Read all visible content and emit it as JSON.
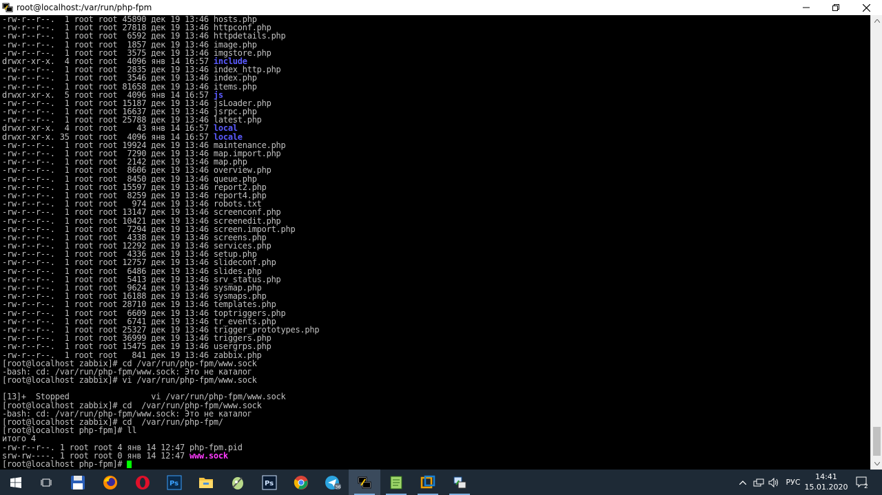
{
  "window": {
    "title": "root@localhost:/var/run/php-fpm"
  },
  "terminal": {
    "lines": [
      {
        "pre": "-rw-r--r--.  1 root root 45890 дек 19 13:46 ",
        "name": "hosts.php",
        "kind": "file"
      },
      {
        "pre": "-rw-r--r--.  1 root root 27818 дек 19 13:46 ",
        "name": "httpconf.php",
        "kind": "file"
      },
      {
        "pre": "-rw-r--r--.  1 root root  6592 дек 19 13:46 ",
        "name": "httpdetails.php",
        "kind": "file"
      },
      {
        "pre": "-rw-r--r--.  1 root root  1857 дек 19 13:46 ",
        "name": "image.php",
        "kind": "file"
      },
      {
        "pre": "-rw-r--r--.  1 root root  3575 дек 19 13:46 ",
        "name": "imgstore.php",
        "kind": "file"
      },
      {
        "pre": "drwxr-xr-x.  4 root root  4096 янв 14 16:57 ",
        "name": "include",
        "kind": "dir"
      },
      {
        "pre": "-rw-r--r--.  1 root root  2835 дек 19 13:46 ",
        "name": "index_http.php",
        "kind": "file"
      },
      {
        "pre": "-rw-r--r--.  1 root root  3546 дек 19 13:46 ",
        "name": "index.php",
        "kind": "file"
      },
      {
        "pre": "-rw-r--r--.  1 root root 81658 дек 19 13:46 ",
        "name": "items.php",
        "kind": "file"
      },
      {
        "pre": "drwxr-xr-x.  5 root root  4096 янв 14 16:57 ",
        "name": "js",
        "kind": "dir"
      },
      {
        "pre": "-rw-r--r--.  1 root root 15187 дек 19 13:46 ",
        "name": "jsLoader.php",
        "kind": "file"
      },
      {
        "pre": "-rw-r--r--.  1 root root 16637 дек 19 13:46 ",
        "name": "jsrpc.php",
        "kind": "file"
      },
      {
        "pre": "-rw-r--r--.  1 root root 25788 дек 19 13:46 ",
        "name": "latest.php",
        "kind": "file"
      },
      {
        "pre": "drwxr-xr-x.  4 root root    43 янв 14 16:57 ",
        "name": "local",
        "kind": "dir"
      },
      {
        "pre": "drwxr-xr-x. 35 root root  4096 янв 14 16:57 ",
        "name": "locale",
        "kind": "dir"
      },
      {
        "pre": "-rw-r--r--.  1 root root 19924 дек 19 13:46 ",
        "name": "maintenance.php",
        "kind": "file"
      },
      {
        "pre": "-rw-r--r--.  1 root root  7290 дек 19 13:46 ",
        "name": "map.import.php",
        "kind": "file"
      },
      {
        "pre": "-rw-r--r--.  1 root root  2142 дек 19 13:46 ",
        "name": "map.php",
        "kind": "file"
      },
      {
        "pre": "-rw-r--r--.  1 root root  8606 дек 19 13:46 ",
        "name": "overview.php",
        "kind": "file"
      },
      {
        "pre": "-rw-r--r--.  1 root root  8450 дек 19 13:46 ",
        "name": "queue.php",
        "kind": "file"
      },
      {
        "pre": "-rw-r--r--.  1 root root 15597 дек 19 13:46 ",
        "name": "report2.php",
        "kind": "file"
      },
      {
        "pre": "-rw-r--r--.  1 root root  8259 дек 19 13:46 ",
        "name": "report4.php",
        "kind": "file"
      },
      {
        "pre": "-rw-r--r--.  1 root root   974 дек 19 13:46 ",
        "name": "robots.txt",
        "kind": "file"
      },
      {
        "pre": "-rw-r--r--.  1 root root 13147 дек 19 13:46 ",
        "name": "screenconf.php",
        "kind": "file"
      },
      {
        "pre": "-rw-r--r--.  1 root root 10421 дек 19 13:46 ",
        "name": "screenedit.php",
        "kind": "file"
      },
      {
        "pre": "-rw-r--r--.  1 root root  7294 дек 19 13:46 ",
        "name": "screen.import.php",
        "kind": "file"
      },
      {
        "pre": "-rw-r--r--.  1 root root  4338 дек 19 13:46 ",
        "name": "screens.php",
        "kind": "file"
      },
      {
        "pre": "-rw-r--r--.  1 root root 12292 дек 19 13:46 ",
        "name": "services.php",
        "kind": "file"
      },
      {
        "pre": "-rw-r--r--.  1 root root  4336 дек 19 13:46 ",
        "name": "setup.php",
        "kind": "file"
      },
      {
        "pre": "-rw-r--r--.  1 root root 12757 дек 19 13:46 ",
        "name": "slideconf.php",
        "kind": "file"
      },
      {
        "pre": "-rw-r--r--.  1 root root  6486 дек 19 13:46 ",
        "name": "slides.php",
        "kind": "file"
      },
      {
        "pre": "-rw-r--r--.  1 root root  5413 дек 19 13:46 ",
        "name": "srv_status.php",
        "kind": "file"
      },
      {
        "pre": "-rw-r--r--.  1 root root  9624 дек 19 13:46 ",
        "name": "sysmap.php",
        "kind": "file"
      },
      {
        "pre": "-rw-r--r--.  1 root root 16188 дек 19 13:46 ",
        "name": "sysmaps.php",
        "kind": "file"
      },
      {
        "pre": "-rw-r--r--.  1 root root 28710 дек 19 13:46 ",
        "name": "templates.php",
        "kind": "file"
      },
      {
        "pre": "-rw-r--r--.  1 root root  6609 дек 19 13:46 ",
        "name": "toptriggers.php",
        "kind": "file"
      },
      {
        "pre": "-rw-r--r--.  1 root root  6741 дек 19 13:46 ",
        "name": "tr_events.php",
        "kind": "file"
      },
      {
        "pre": "-rw-r--r--.  1 root root 25327 дек 19 13:46 ",
        "name": "trigger_prototypes.php",
        "kind": "file"
      },
      {
        "pre": "-rw-r--r--.  1 root root 36999 дек 19 13:46 ",
        "name": "triggers.php",
        "kind": "file"
      },
      {
        "pre": "-rw-r--r--.  1 root root 15475 дек 19 13:46 ",
        "name": "usergrps.php",
        "kind": "file"
      },
      {
        "pre": "-rw-r--r--.  1 root root   841 дек 19 13:46 ",
        "name": "zabbix.php",
        "kind": "file"
      },
      {
        "pre": "[root@localhost zabbix]# cd /var/run/php-fpm/www.sock",
        "name": "",
        "kind": "text"
      },
      {
        "pre": "-bash: cd: /var/run/php-fpm/www.sock: Это не каталог",
        "name": "",
        "kind": "text"
      },
      {
        "pre": "[root@localhost zabbix]# vi /var/run/php-fpm/www.sock",
        "name": "",
        "kind": "text"
      },
      {
        "pre": "",
        "name": "",
        "kind": "text"
      },
      {
        "pre": "[13]+  Stopped                 vi /var/run/php-fpm/www.sock",
        "name": "",
        "kind": "text"
      },
      {
        "pre": "[root@localhost zabbix]# cd  /var/run/php-fpm/www.sock",
        "name": "",
        "kind": "text"
      },
      {
        "pre": "-bash: cd: /var/run/php-fpm/www.sock: Это не каталог",
        "name": "",
        "kind": "text"
      },
      {
        "pre": "[root@localhost zabbix]# cd  /var/run/php-fpm/",
        "name": "",
        "kind": "text"
      },
      {
        "pre": "[root@localhost php-fpm]# ll",
        "name": "",
        "kind": "text"
      },
      {
        "pre": "итого 4",
        "name": "",
        "kind": "text"
      },
      {
        "pre": "-rw-r--r--. 1 root root 4 янв 14 12:47 ",
        "name": "php-fpm.pid",
        "kind": "file"
      },
      {
        "pre": "srw-rw----. 1 root root 0 янв 14 12:47 ",
        "name": "www.sock",
        "kind": "sock"
      },
      {
        "pre": "[root@localhost php-fpm]# ",
        "name": "",
        "kind": "prompt"
      }
    ]
  },
  "taskbar": {
    "icons": [
      "windows-start-icon",
      "task-view-icon",
      "floppy-disk-icon",
      "firefox-icon",
      "opera-icon",
      "photoshop-icon",
      "file-explorer-icon",
      "notepad-plus-icon",
      "photoshop-icon",
      "chrome-icon",
      "telegram-icon",
      "putty-icon",
      "notepad-icon",
      "virtualbox-icon",
      "network-app-icon"
    ],
    "telegram_badge": "36",
    "language": "РУС",
    "time": "14:41",
    "date": "15.01.2020",
    "notification_count": "2"
  },
  "colors": {
    "directory": "#5b5bff",
    "socket": "#ff3cff",
    "cursor": "#00ff00",
    "text": "#c0c0c0",
    "taskbar": "#1e2a36"
  }
}
